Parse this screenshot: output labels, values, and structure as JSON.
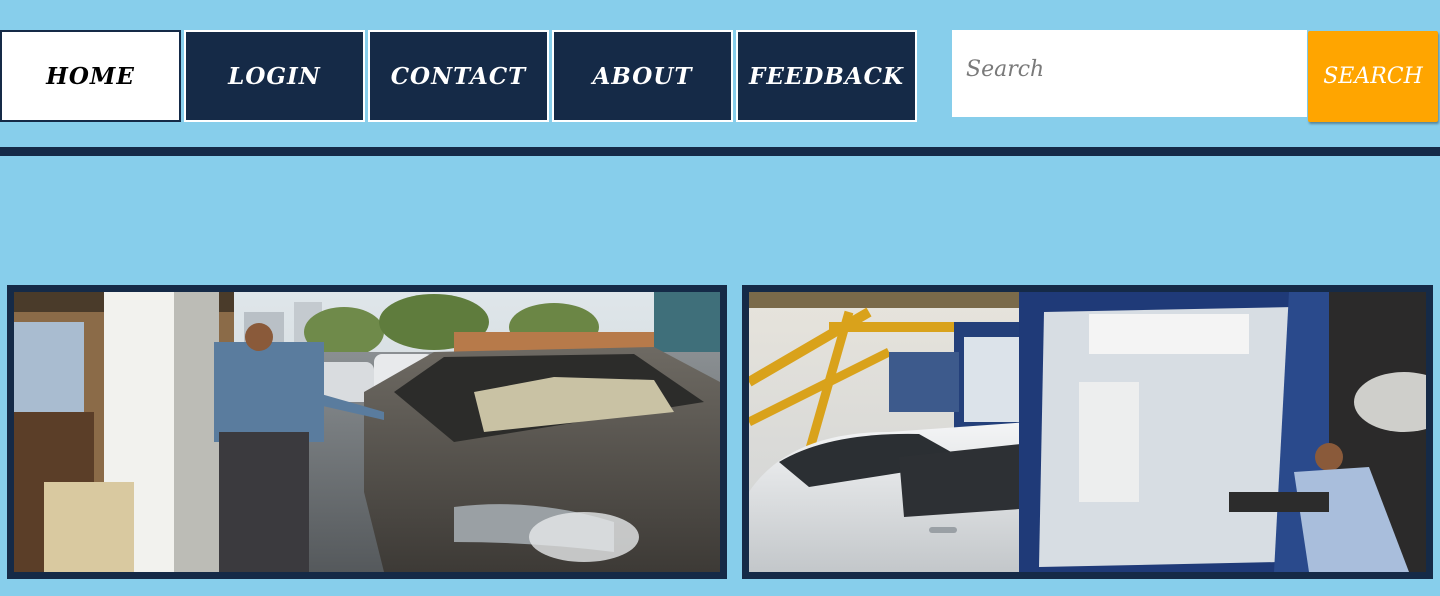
{
  "nav": {
    "items": [
      {
        "label": "HOME",
        "active": true
      },
      {
        "label": "LOGIN",
        "active": false
      },
      {
        "label": "CONTACT",
        "active": false
      },
      {
        "label": "ABOUT",
        "active": false
      },
      {
        "label": "FEEDBACK",
        "active": false
      }
    ]
  },
  "search": {
    "placeholder": "Search",
    "value": "",
    "button_label": "SEARCH"
  },
  "gallery": {
    "images": [
      {
        "name": "toll-booth-cash-payment-photo"
      },
      {
        "name": "toll-booth-operator-photo"
      }
    ]
  },
  "colors": {
    "page_background": "#87CEEB",
    "nav_background": "#152a47",
    "nav_active_background": "#ffffff",
    "search_button": "#FFA500",
    "divider": "#152a47"
  }
}
